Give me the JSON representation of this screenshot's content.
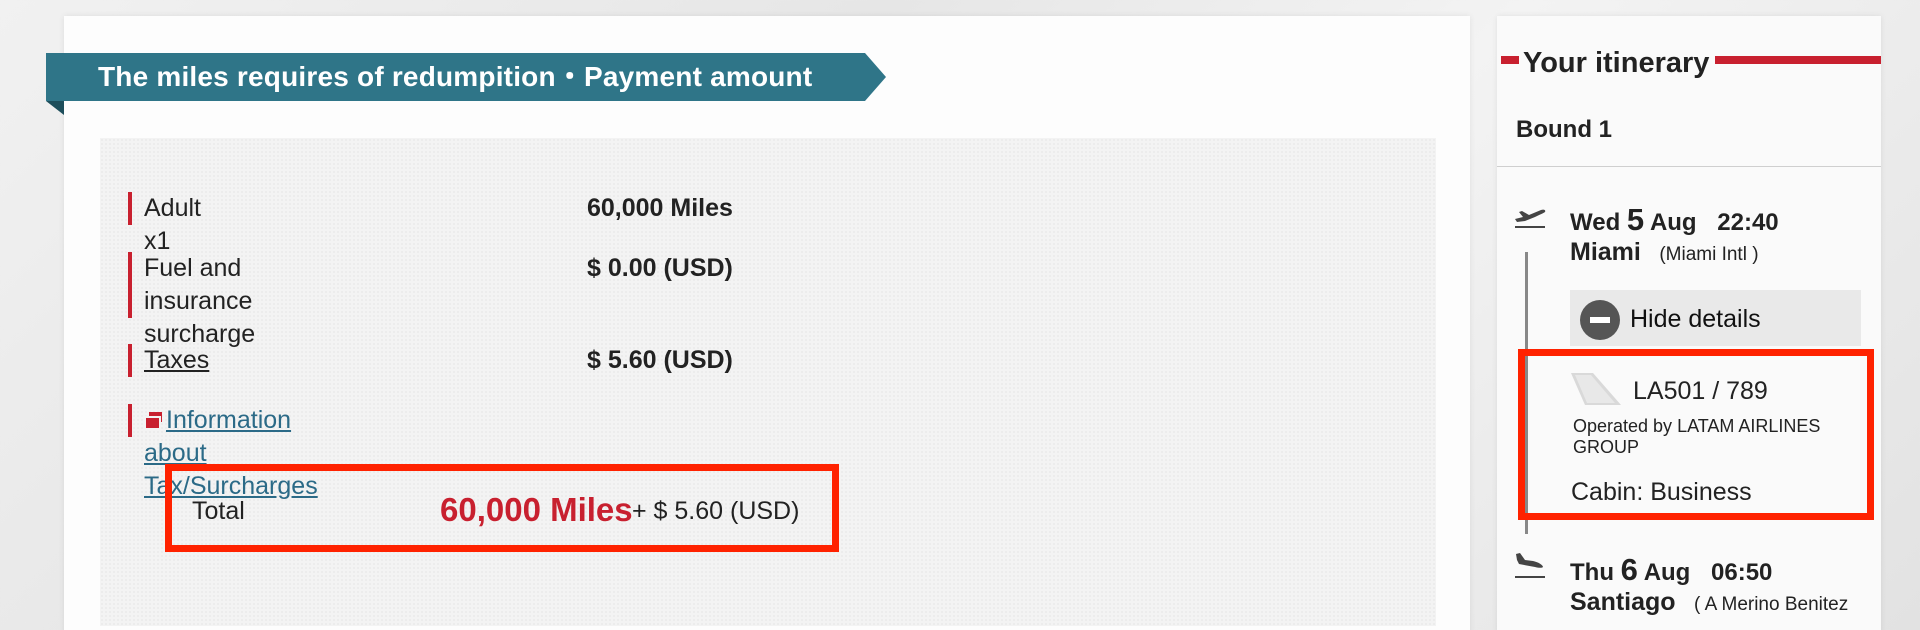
{
  "payment": {
    "banner_title": "The miles requires of redumpition・Payment amount",
    "rows": [
      {
        "label": "Adult x1",
        "value": "60,000 Miles"
      },
      {
        "label": "Fuel and insurance",
        "label_line2": "surcharge",
        "value": "$ 0.00 (USD)"
      },
      {
        "label": "Taxes",
        "value": "$ 5.60 (USD)"
      }
    ],
    "info_link": "Information about Tax/Surcharges",
    "total": {
      "label": "Total",
      "miles": "60,000 Miles",
      "plus_amount": "+ $ 5.60 (USD)"
    }
  },
  "itinerary": {
    "title": "Your itinerary",
    "bound": "Bound 1",
    "departure": {
      "weekday": "Wed",
      "day": "5",
      "month": "Aug",
      "time": "22:40",
      "city": "Miami",
      "airport": "(Miami Intl )"
    },
    "details_toggle": "Hide details",
    "flight": {
      "number": "LA501  /  789",
      "operated_by": "Operated by LATAM AIRLINES GROUP",
      "cabin": "Cabin: Business"
    },
    "arrival": {
      "weekday": "Thu",
      "day": "6",
      "month": "Aug",
      "time": "06:50",
      "city": "Santiago",
      "airport": "( A Merino Benitez"
    }
  },
  "colors": {
    "banner": "#2f7588",
    "accent_red": "#c8202f",
    "highlight_border": "#ff2200",
    "link": "#2b6a87"
  },
  "icons": [
    "takeoff-icon",
    "landing-icon",
    "minus-circle-icon",
    "tail-logo-icon",
    "info-icon"
  ]
}
